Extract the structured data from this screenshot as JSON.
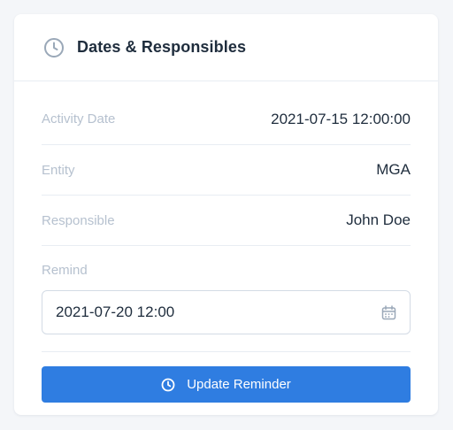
{
  "card": {
    "title": "Dates & Responsibles",
    "header_icon": "clock-icon"
  },
  "details": [
    {
      "label": "Activity Date",
      "value": "2021-07-15 12:00:00"
    },
    {
      "label": "Entity",
      "value": "MGA"
    },
    {
      "label": "Responsible",
      "value": "John Doe"
    }
  ],
  "remind": {
    "label": "Remind",
    "value": "2021-07-20 12:00",
    "icon": "calendar-icon"
  },
  "update_button": {
    "label": "Update Reminder",
    "icon": "clock-icon"
  },
  "colors": {
    "accent": "#2f7de1",
    "label": "#b6c1cf",
    "text": "#1f2d3d",
    "icon": "#9aa8b8",
    "border": "#e8edf3"
  }
}
